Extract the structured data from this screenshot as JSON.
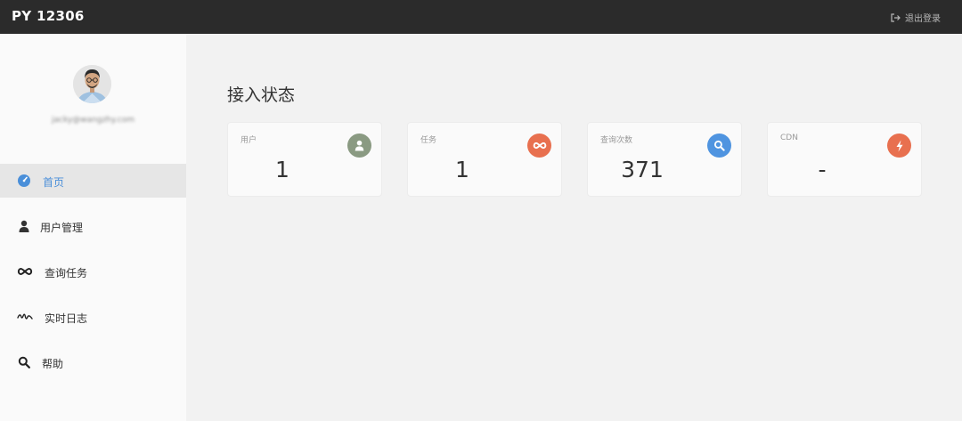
{
  "header": {
    "brand": "PY 12306",
    "logout_label": "退出登录"
  },
  "sidebar": {
    "user_email": "jacky@wangzhy.com",
    "items": [
      {
        "label": "首页",
        "icon": "dashboard-icon",
        "active": true
      },
      {
        "label": "用户管理",
        "icon": "user-icon",
        "active": false
      },
      {
        "label": "查询任务",
        "icon": "infinity-icon",
        "active": false
      },
      {
        "label": "实时日志",
        "icon": "signature-icon",
        "active": false
      },
      {
        "label": "帮助",
        "icon": "search-icon",
        "active": false
      }
    ]
  },
  "main": {
    "title": "接入状态",
    "cards": [
      {
        "label": "用户",
        "value": "1",
        "icon": "user-icon",
        "color": "#8a9a82"
      },
      {
        "label": "任务",
        "value": "1",
        "icon": "infinity-icon",
        "color": "#e8704f"
      },
      {
        "label": "查询次数",
        "value": "371",
        "icon": "search-icon",
        "color": "#4f94e0"
      },
      {
        "label": "CDN",
        "value": "-",
        "icon": "bolt-icon",
        "color": "#e8704f"
      }
    ]
  },
  "colors": {
    "topbar": "#2b2b2b",
    "sidebar": "#fafafa",
    "active_nav": "#e6e6e6",
    "accent": "#4a8fd9"
  }
}
